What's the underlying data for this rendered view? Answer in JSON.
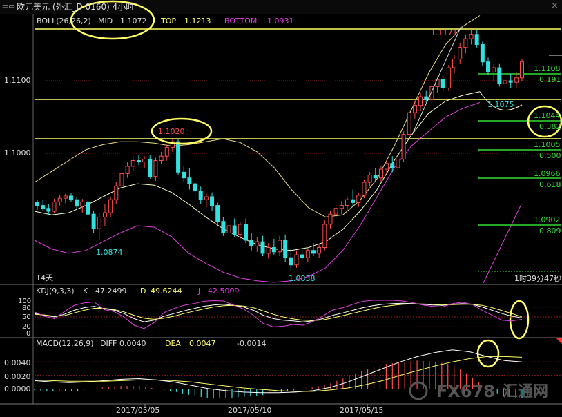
{
  "window": {
    "icon": "window-menu-icon",
    "title": "欧元美元 (外汇_D 0160) 4小时",
    "close_glyph": "×"
  },
  "boll_header": {
    "label": "BOLL(26,26,2)",
    "mid_label": "MID",
    "mid_value": "1.1072",
    "top_label": "TOP",
    "top_value": "1.1213",
    "bottom_label": "BOTTOM",
    "bottom_value": "1.0931"
  },
  "kdj_header": {
    "label": "KDJ(9,3,3)",
    "k_label": "K",
    "k_value": "47.2499",
    "d_label": "D",
    "d_value": "49.6244",
    "j_label": "J",
    "j_value": "42.5009"
  },
  "macd_header": {
    "label": "MACD(12,26,9)",
    "diff_label": "DIFF",
    "diff_value": "0.0040",
    "dea_label": "DEA",
    "dea_value": "0.0047",
    "hist_value": "-0.0014"
  },
  "annotations": {
    "high": "1.1171",
    "peak": "1.1020",
    "low_left": "1.0874",
    "low_mid": "1.0838",
    "pullback": "1.1075",
    "period": "14天",
    "countdown": "1时39分47秒"
  },
  "fib_levels": [
    {
      "price": "1.1108",
      "ratio": "0.191"
    },
    {
      "price": "1.1044",
      "ratio": "0.382"
    },
    {
      "price": "1.1005",
      "ratio": "0.500"
    },
    {
      "price": "1.0966",
      "ratio": "0.618"
    },
    {
      "price": "1.0902",
      "ratio": "0.809"
    }
  ],
  "watermark": {
    "brand": "FX678",
    "cn": "汇通网"
  },
  "colors": {
    "up": "#ff4d4d",
    "down": "#33e0e0",
    "yellow": "#ffff66",
    "magenta": "#e040e0",
    "green": "#33dd33",
    "boll_line": "#ffffcc"
  },
  "chart_data": [
    {
      "type": "candlestick",
      "title": "欧元美元 4小时",
      "x": [
        "2017/05/05",
        "2017/05/10",
        "2017/05/15"
      ],
      "y_ticks": [
        1.1,
        1.11
      ],
      "ylim": [
        1.0825,
        1.118
      ],
      "grid": true,
      "candles": [
        [
          1.0932,
          1.0935,
          1.0922,
          1.0928
        ],
        [
          1.0928,
          1.0936,
          1.092,
          1.0924
        ],
        [
          1.0924,
          1.093,
          1.0915,
          1.092
        ],
        [
          1.092,
          1.0937,
          1.0917,
          1.0933
        ],
        [
          1.0933,
          1.0942,
          1.0928,
          1.0938
        ],
        [
          1.0938,
          1.0944,
          1.0931,
          1.0941
        ],
        [
          1.0941,
          1.0945,
          1.0933,
          1.0936
        ],
        [
          1.0936,
          1.094,
          1.0922,
          1.0927
        ],
        [
          1.0927,
          1.0937,
          1.0918,
          1.0933
        ],
        [
          1.0933,
          1.0938,
          1.0912,
          1.0916
        ],
        [
          1.0916,
          1.092,
          1.089,
          1.0896
        ],
        [
          1.0896,
          1.0918,
          1.088,
          1.0912
        ],
        [
          1.0912,
          1.093,
          1.09,
          1.0918
        ],
        [
          1.0918,
          1.094,
          1.0912,
          1.0936
        ],
        [
          1.0936,
          1.096,
          1.093,
          1.0955
        ],
        [
          1.0955,
          1.0976,
          1.095,
          1.0972
        ],
        [
          1.0972,
          1.0988,
          1.0966,
          1.0982
        ],
        [
          1.0982,
          1.0996,
          1.0975,
          1.099
        ],
        [
          1.099,
          1.0998,
          1.0984,
          1.0988
        ],
        [
          1.0988,
          1.0996,
          1.098,
          1.0992
        ],
        [
          1.0992,
          1.0997,
          1.0965,
          1.0968
        ],
        [
          1.0968,
          1.0994,
          1.0962,
          1.099
        ],
        [
          1.099,
          1.1002,
          1.0985,
          1.0996
        ],
        [
          1.0996,
          1.1012,
          1.099,
          1.1008
        ],
        [
          1.1008,
          1.102,
          1.1002,
          1.1016
        ],
        [
          1.1016,
          1.102,
          1.097,
          1.0974
        ],
        [
          1.0974,
          1.0982,
          1.096,
          1.0966
        ],
        [
          1.0966,
          1.098,
          1.095,
          1.0958
        ],
        [
          1.0958,
          1.0962,
          1.094,
          1.0948
        ],
        [
          1.0948,
          1.0954,
          1.093,
          1.0936
        ],
        [
          1.0936,
          1.0945,
          1.0926,
          1.094
        ],
        [
          1.094,
          1.0946,
          1.092,
          1.0928
        ],
        [
          1.0928,
          1.0932,
          1.09,
          1.0906
        ],
        [
          1.0906,
          1.0912,
          1.0886,
          1.089
        ],
        [
          1.089,
          1.0905,
          1.0883,
          1.09
        ],
        [
          1.09,
          1.091,
          1.0884,
          1.0888
        ],
        [
          1.0888,
          1.0905,
          1.0882,
          1.0902
        ],
        [
          1.0902,
          1.091,
          1.0876,
          1.088
        ],
        [
          1.088,
          1.089,
          1.0866,
          1.0872
        ],
        [
          1.0872,
          1.0884,
          1.0864,
          1.0878
        ],
        [
          1.0878,
          1.0886,
          1.0858,
          1.0862
        ],
        [
          1.0862,
          1.0876,
          1.0855,
          1.087
        ],
        [
          1.087,
          1.0882,
          1.086,
          1.0864
        ],
        [
          1.0864,
          1.0886,
          1.0858,
          1.088
        ],
        [
          1.088,
          1.0888,
          1.085,
          1.0856
        ],
        [
          1.0856,
          1.0868,
          1.0838,
          1.0846
        ],
        [
          1.0846,
          1.0866,
          1.0842,
          1.086
        ],
        [
          1.086,
          1.0868,
          1.0852,
          1.0856
        ],
        [
          1.0856,
          1.087,
          1.085,
          1.0866
        ],
        [
          1.0866,
          1.0876,
          1.0858,
          1.0862
        ],
        [
          1.0862,
          1.0874,
          1.0856,
          1.087
        ],
        [
          1.087,
          1.0908,
          1.0866,
          1.0902
        ],
        [
          1.0902,
          1.092,
          1.0896,
          1.0916
        ],
        [
          1.0916,
          1.093,
          1.091,
          1.0924
        ],
        [
          1.0924,
          1.0934,
          1.0916,
          1.0928
        ],
        [
          1.0928,
          1.094,
          1.0922,
          1.0936
        ],
        [
          1.0936,
          1.095,
          1.0928,
          1.0932
        ],
        [
          1.0932,
          1.0946,
          1.0926,
          1.0942
        ],
        [
          1.0942,
          1.0964,
          1.0938,
          1.096
        ],
        [
          1.096,
          1.0974,
          1.0954,
          1.097
        ],
        [
          1.097,
          1.098,
          1.0962,
          1.0966
        ],
        [
          1.0966,
          1.0982,
          1.096,
          1.0978
        ],
        [
          1.0978,
          1.099,
          1.097,
          1.0986
        ],
        [
          1.0986,
          1.0996,
          1.0974,
          1.098
        ],
        [
          1.098,
          1.0994,
          1.0976,
          1.0992
        ],
        [
          1.0992,
          1.103,
          1.0988,
          1.1026
        ],
        [
          1.1026,
          1.106,
          1.102,
          1.1056
        ],
        [
          1.1056,
          1.1072,
          1.1048,
          1.1066
        ],
        [
          1.1066,
          1.1084,
          1.1058,
          1.1078
        ],
        [
          1.1078,
          1.1086,
          1.107,
          1.1074
        ],
        [
          1.1074,
          1.1096,
          1.1068,
          1.1092
        ],
        [
          1.1092,
          1.1106,
          1.1084,
          1.1102
        ],
        [
          1.1102,
          1.1108,
          1.1086,
          1.109
        ],
        [
          1.109,
          1.1122,
          1.1086,
          1.1118
        ],
        [
          1.1118,
          1.1136,
          1.111,
          1.113
        ],
        [
          1.113,
          1.1152,
          1.1124,
          1.1146
        ],
        [
          1.1146,
          1.1164,
          1.1138,
          1.1158
        ],
        [
          1.1158,
          1.1171,
          1.115,
          1.1164
        ],
        [
          1.1164,
          1.117,
          1.1146,
          1.115
        ],
        [
          1.115,
          1.1154,
          1.112,
          1.1126
        ],
        [
          1.1126,
          1.1132,
          1.1108,
          1.1112
        ],
        [
          1.1112,
          1.1124,
          1.11,
          1.1118
        ],
        [
          1.1118,
          1.1124,
          1.1092,
          1.1096
        ],
        [
          1.1096,
          1.1104,
          1.1075,
          1.11
        ],
        [
          1.11,
          1.111,
          1.109,
          1.1098
        ],
        [
          1.1098,
          1.1112,
          1.109,
          1.1104
        ],
        [
          1.1104,
          1.113,
          1.11,
          1.1126
        ]
      ],
      "series": [
        {
          "name": "TOP",
          "values": [
            1.096,
            1.0975,
            1.099,
            1.1005,
            1.1012,
            1.1016,
            1.1016,
            1.1014,
            1.101,
            1.1012,
            1.1016,
            1.102,
            1.1015,
            1.1002,
            1.098,
            1.095,
            1.0925,
            1.0912,
            1.0915,
            1.0935,
            1.0965,
            1.101,
            1.106,
            1.111,
            1.115,
            1.1175,
            1.119
          ]
        },
        {
          "name": "MID",
          "values": [
            1.092,
            1.0915,
            1.0918,
            1.0928,
            1.094,
            1.0952,
            1.0958,
            1.0956,
            1.0946,
            1.093,
            1.0912,
            1.0896,
            1.0884,
            1.0874,
            1.0868,
            1.0866,
            1.087,
            1.0878,
            1.0895,
            1.092,
            1.095,
            1.099,
            1.1025,
            1.1055,
            1.1072,
            1.108,
            1.1085
          ]
        },
        {
          "name": "BOTTOM",
          "values": [
            1.088,
            1.0868,
            1.0862,
            1.0866,
            1.0878,
            1.089,
            1.09,
            1.0898,
            1.0885,
            1.0862,
            1.0848,
            1.0836,
            1.0828,
            1.0824,
            1.0822,
            1.0824,
            1.083,
            1.0842,
            1.0866,
            1.09,
            1.094,
            1.098,
            1.101,
            1.103,
            1.105,
            1.1062,
            1.107
          ]
        }
      ]
    },
    {
      "type": "line",
      "title": "KDJ(9,3,3)",
      "ylim": [
        0,
        100
      ],
      "y_ticks": [
        0,
        20,
        50,
        80,
        100
      ],
      "series": [
        {
          "name": "K",
          "values": [
            60,
            55,
            50,
            58,
            70,
            78,
            82,
            75,
            70,
            60,
            45,
            35,
            40,
            52,
            60,
            68,
            75,
            82,
            86,
            88,
            85,
            80,
            70,
            55,
            45,
            40,
            38,
            35,
            38,
            45,
            55,
            62,
            70,
            78,
            84,
            88,
            90,
            91,
            90,
            88,
            86,
            85,
            88,
            90,
            88,
            80,
            70,
            60,
            52,
            47
          ]
        },
        {
          "name": "D",
          "values": [
            58,
            56,
            52,
            54,
            62,
            70,
            76,
            76,
            72,
            65,
            55,
            46,
            43,
            46,
            52,
            60,
            67,
            74,
            80,
            84,
            85,
            83,
            78,
            68,
            58,
            50,
            44,
            40,
            39,
            41,
            47,
            54,
            61,
            68,
            75,
            81,
            85,
            88,
            89,
            89,
            88,
            87,
            87,
            88,
            88,
            85,
            78,
            69,
            60,
            50
          ]
        },
        {
          "name": "J",
          "values": [
            65,
            52,
            45,
            66,
            85,
            92,
            95,
            72,
            66,
            50,
            25,
            15,
            32,
            63,
            75,
            85,
            90,
            97,
            99,
            98,
            86,
            74,
            55,
            30,
            20,
            22,
            27,
            25,
            36,
            53,
            71,
            78,
            88,
            97,
            100,
            100,
            100,
            98,
            93,
            86,
            82,
            80,
            90,
            94,
            88,
            70,
            55,
            40,
            38,
            43
          ]
        }
      ]
    },
    {
      "type": "bar",
      "title": "MACD(12,26,9)",
      "y_ticks": [
        0.0,
        0.002,
        0.004
      ],
      "ylim": [
        -0.001,
        0.0062
      ],
      "series": [
        {
          "name": "DIFF",
          "values": [
            0.0012,
            0.001,
            0.0009,
            0.001,
            0.0012,
            0.0014,
            0.0015,
            0.0013,
            0.001,
            0.0005,
            0.0,
            -0.0003,
            -0.0005,
            -0.0006,
            -0.0006,
            -0.0005,
            -0.0003,
            0.0002,
            0.001,
            0.002,
            0.003,
            0.004,
            0.0048,
            0.0054,
            0.0058,
            0.0055,
            0.0048,
            0.0042,
            0.004
          ]
        },
        {
          "name": "DEA",
          "values": [
            0.0013,
            0.0012,
            0.0011,
            0.0011,
            0.0011,
            0.0012,
            0.0013,
            0.0013,
            0.0012,
            0.001,
            0.0007,
            0.0004,
            0.0001,
            -0.0001,
            -0.0003,
            -0.0004,
            -0.0004,
            -0.0002,
            0.0001,
            0.0006,
            0.0012,
            0.002,
            0.0027,
            0.0034,
            0.004,
            0.0045,
            0.0048,
            0.0048,
            0.0047
          ]
        }
      ]
    }
  ]
}
